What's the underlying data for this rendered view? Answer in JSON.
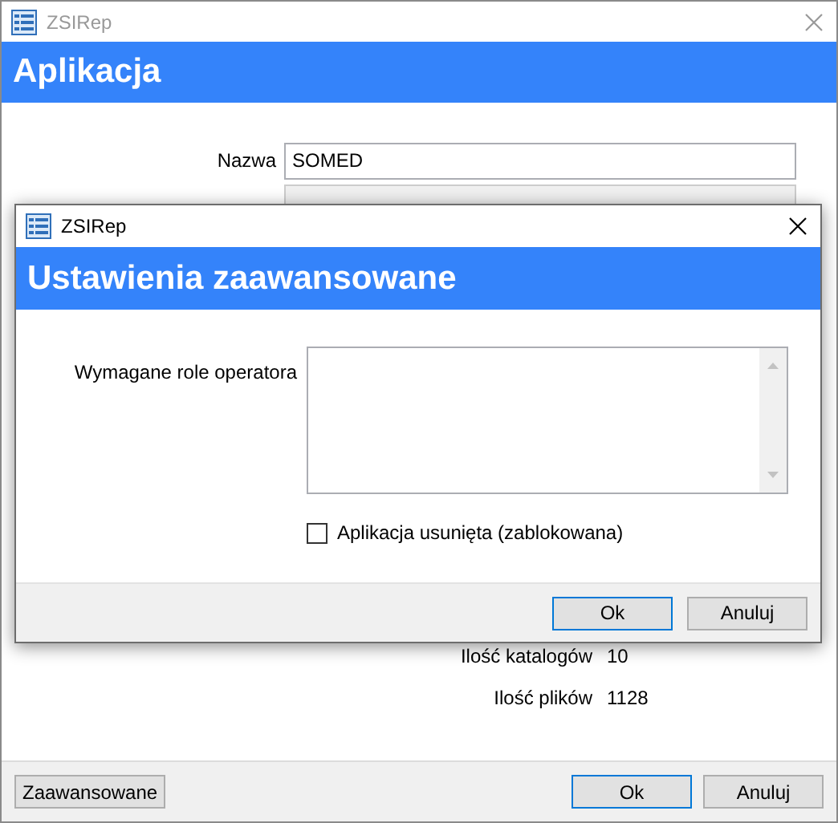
{
  "window": {
    "title": "ZSIRep",
    "header": "Aplikacja"
  },
  "fields": [
    {
      "label": "Nazwa",
      "value": "SOMED",
      "disabled": false
    },
    {
      "disabled": true
    }
  ],
  "stats": [
    {
      "label": "Ilość katalogów",
      "value": "10"
    },
    {
      "label": "Ilość plików",
      "value": "1128"
    }
  ],
  "left_button": "Zaawansowane",
  "buttons": [
    {
      "label": "Ok",
      "default": true
    },
    {
      "label": "Anuluj",
      "default": false
    }
  ],
  "dialog": {
    "title": "ZSIRep",
    "header": "Ustawienia zaawansowane",
    "roles_label": "Wymagane role operatora",
    "checkbox": {
      "label": "Aplikacja usunięta (zablokowana)",
      "checked": false
    },
    "buttons": [
      {
        "label": "Ok",
        "default": true
      },
      {
        "label": "Anuluj",
        "default": false
      }
    ]
  }
}
